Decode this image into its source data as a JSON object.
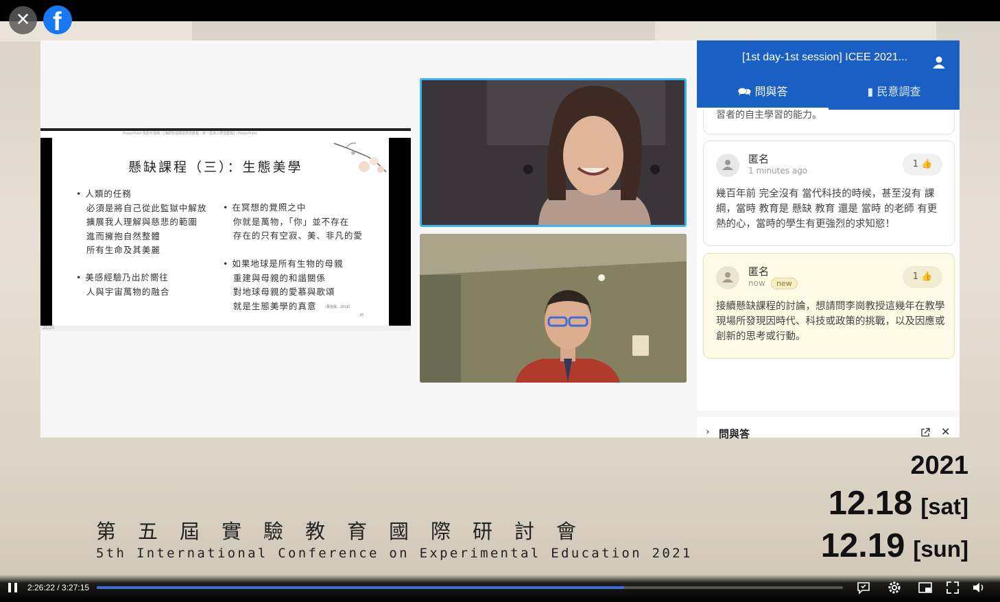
{
  "header": {
    "close_label": "✕",
    "logo_label": "f"
  },
  "slide": {
    "title": "懸缺課程（三）：生態美學",
    "tiny_header": "PowerPoint 投影片放映 - [海研所發展與學習歷程 - 高一至高三學習歷程] - PowerPoint",
    "left_block_1": "• 人類的任務\n   必須是將自己從此監獄中解放\n   擴展我人理解與慈悲的範圍\n   進而擁抱自然整體\n   所有生命及其美麗",
    "left_block_2": "• 美感經驗乃出於嚮往\n   人與宇宙萬物的融合",
    "right_block_1": "• 在冥想的覺照之中\n   你就是萬物，「你」並不存在\n   存在的只有空寂、美、非凡的愛",
    "right_block_2": "• 如果地球是所有生物的母親\n   重建與母親的和諧關係\n   對地球母親的愛慕與歌頌\n   就是生態美學的真意",
    "citation": "（萬曾晨，2016）",
    "page_number": "25",
    "slide_counter": "25/25"
  },
  "panel": {
    "title": "[1st day-1st session] ICEE 2021...",
    "tab_qa": "問與答",
    "tab_poll": "民意調查",
    "previous_snippet": "習者的自主學習的能力。",
    "questions": [
      {
        "author": "匿名",
        "time": "1 minutes ago",
        "likes": "1",
        "text": "幾百年前 完全沒有 當代科技的時候，甚至沒有 課綱，當時 教育是 懸缺 教育 還是 當時 的老師 有更熱的心，當時的學生有更強烈的求知慾！"
      },
      {
        "author": "匿名",
        "time": "now",
        "badge": "new",
        "likes": "1",
        "text": "接續懸缺課程的討論，想請問李崗教授這幾年在教學現場所發現因時代、科技或政策的挑戰，以及因應或創新的思考或行動。"
      }
    ],
    "footer_label": "問與答",
    "footer_chevron": "›",
    "footer_close": "✕"
  },
  "banner": {
    "title_cn": "第五屆實驗教育國際研討會",
    "title_en": "5th International Conference on Experimental Education 2021",
    "year": "2021",
    "date1": "12.18",
    "day1": "[sat]",
    "date2": "12.19",
    "day2": "[sun]"
  },
  "player": {
    "timecode": "2:26:22 / 3:27:15",
    "progress_fraction": 0.707,
    "icons": [
      "pause-icon",
      "captions-icon",
      "settings-icon",
      "miniplayer-icon",
      "fullscreen-icon",
      "volume-icon"
    ]
  },
  "colors": {
    "panel_header": "#1a5fc4",
    "active_speaker_border": "#36b5f2",
    "progress": "#3a6fe0",
    "highlight_card": "#fffbe6"
  }
}
